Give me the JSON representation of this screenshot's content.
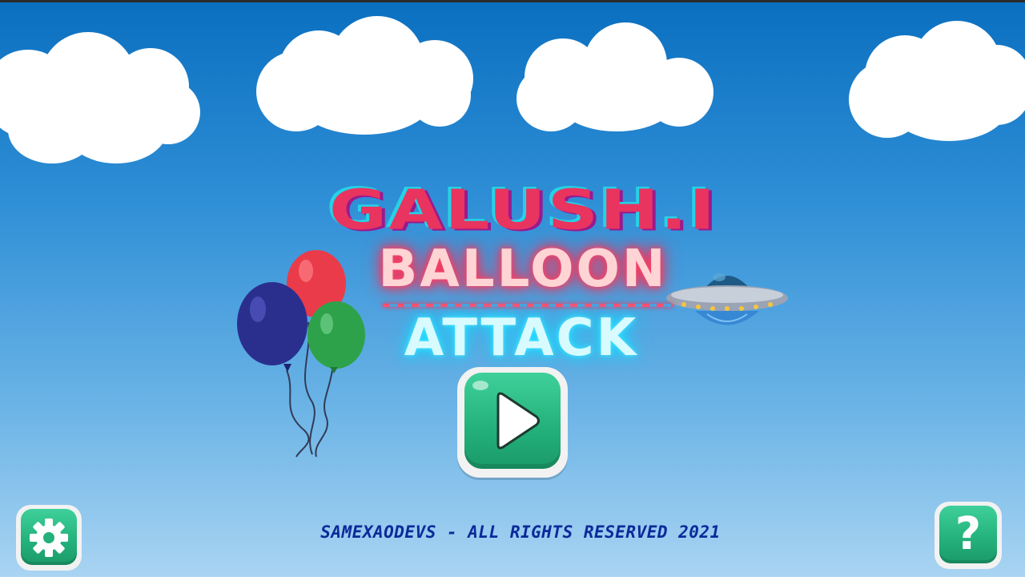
{
  "game": {
    "title_line1": "GALUSH.I",
    "title_line2": "BALLOON",
    "title_line3": "ATTACK"
  },
  "footer": {
    "copyright": "SAMEXAODEVS - ALL RIGHTS RESERVED 2021"
  },
  "buttons": {
    "play_icon": "play-icon",
    "settings_icon": "gear-icon",
    "help_label": "?"
  },
  "colors": {
    "sky_top": "#0a6fc0",
    "sky_bottom": "#a9d4f2",
    "button_green": "#23b07a",
    "title_pink": "#e8345f",
    "neon_red": "#ff2d55",
    "neon_cyan": "#19d6ff",
    "copyright_blue": "#0b2a9a"
  }
}
